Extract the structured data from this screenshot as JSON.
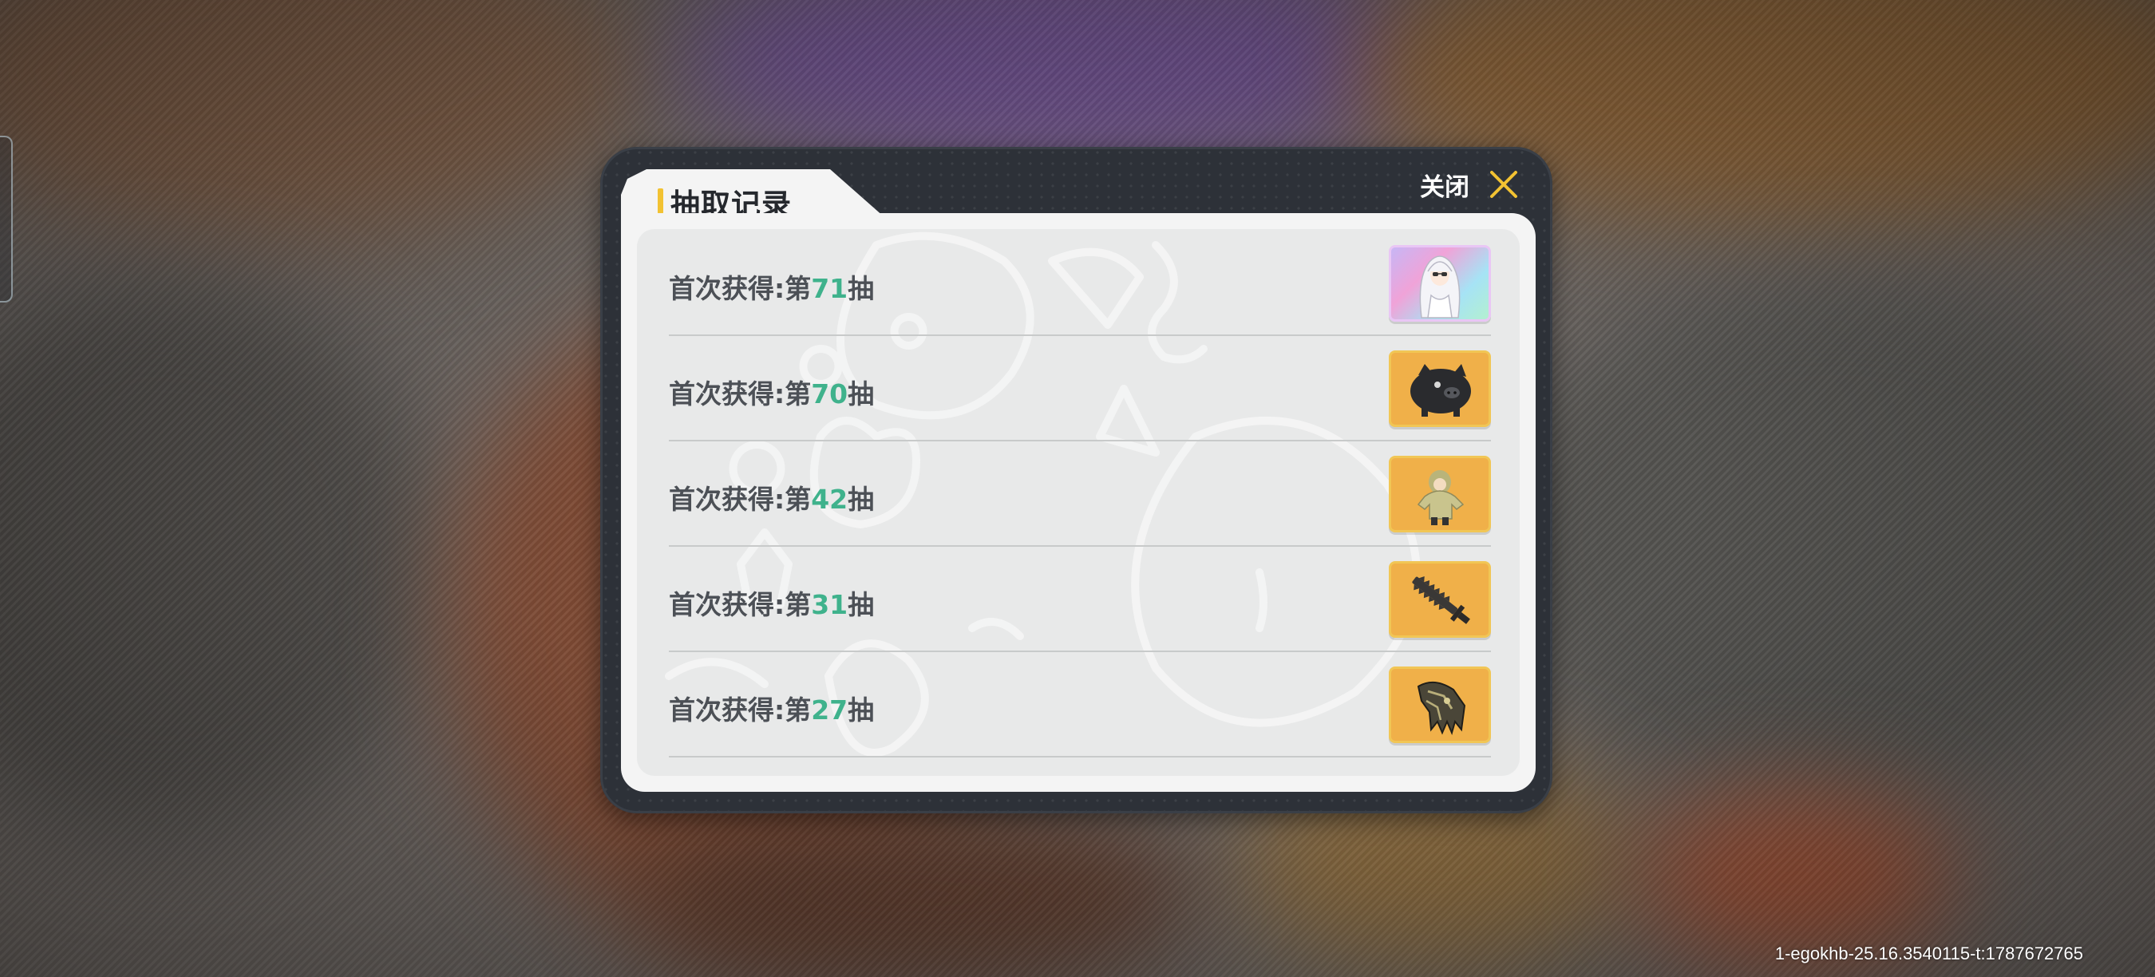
{
  "dialog": {
    "title": "抽取记录",
    "close_label": "关闭",
    "close_icon": "close-x-icon",
    "accent_color": "#f2c232",
    "number_color": "#3fb28c"
  },
  "records": [
    {
      "prefix": "首次获得:第",
      "number": "71",
      "suffix": "抽",
      "item_icon": "white-haired-character-icon",
      "rarity_bg": "holographic"
    },
    {
      "prefix": "首次获得:第",
      "number": "70",
      "suffix": "抽",
      "item_icon": "black-pig-icon",
      "rarity_bg": "#f0b049"
    },
    {
      "prefix": "首次获得:第",
      "number": "42",
      "suffix": "抽",
      "item_icon": "hooded-doll-icon",
      "rarity_bg": "#f0b049"
    },
    {
      "prefix": "首次获得:第",
      "number": "31",
      "suffix": "抽",
      "item_icon": "serrated-sword-icon",
      "rarity_bg": "#f0b049"
    },
    {
      "prefix": "首次获得:第",
      "number": "27",
      "suffix": "抽",
      "item_icon": "mechanical-gauntlet-icon",
      "rarity_bg": "#f0b049"
    }
  ],
  "build_info": "1-egokhb-25.16.3540115-t:1787672765"
}
